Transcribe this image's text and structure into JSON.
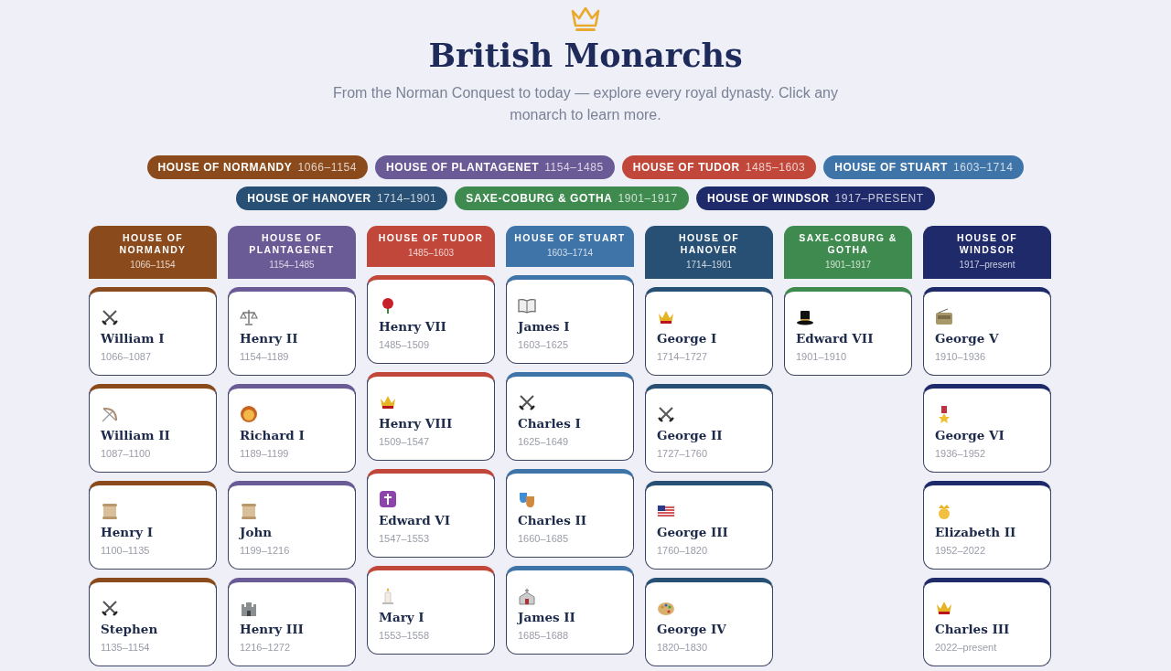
{
  "page": {
    "title": "British Monarchs",
    "subtitle": "From the Norman Conquest to today — explore every royal dynasty. Click any monarch to learn more."
  },
  "legend": [
    {
      "name": "HOUSE OF NORMANDY",
      "dates": "1066–1154",
      "color": "#8b4a1c"
    },
    {
      "name": "HOUSE OF PLANTAGENET",
      "dates": "1154–1485",
      "color": "#6a5a96"
    },
    {
      "name": "HOUSE OF TUDOR",
      "dates": "1485–1603",
      "color": "#c0473a"
    },
    {
      "name": "HOUSE OF STUART",
      "dates": "1603–1714",
      "color": "#3f74a8"
    },
    {
      "name": "HOUSE OF HANOVER",
      "dates": "1714–1901",
      "color": "#284f74"
    },
    {
      "name": "SAXE-COBURG & GOTHA",
      "dates": "1901–1917",
      "color": "#3f8a4f"
    },
    {
      "name": "HOUSE OF WINDSOR",
      "dates": "1917–PRESENT",
      "color": "#1f2a6a"
    }
  ],
  "houses": [
    {
      "name": "HOUSE OF NORMANDY",
      "dates": "1066–1154",
      "color": "#8b4a1c",
      "monarchs": [
        {
          "name": "William I",
          "reign": "1066–1087"
        },
        {
          "name": "William II",
          "reign": "1087–1100"
        },
        {
          "name": "Henry I",
          "reign": "1100–1135"
        },
        {
          "name": "Stephen",
          "reign": "1135–1154"
        }
      ]
    },
    {
      "name": "HOUSE OF PLANTAGENET",
      "dates": "1154–1485",
      "color": "#6a5a96",
      "monarchs": [
        {
          "name": "Henry II",
          "reign": "1154–1189"
        },
        {
          "name": "Richard I",
          "reign": "1189–1199"
        },
        {
          "name": "John",
          "reign": "1199–1216"
        },
        {
          "name": "Henry III",
          "reign": "1216–1272"
        }
      ]
    },
    {
      "name": "HOUSE OF TUDOR",
      "dates": "1485–1603",
      "color": "#c0473a",
      "monarchs": [
        {
          "name": "Henry VII",
          "reign": "1485–1509"
        },
        {
          "name": "Henry VIII",
          "reign": "1509–1547"
        },
        {
          "name": "Edward VI",
          "reign": "1547–1553"
        },
        {
          "name": "Mary I",
          "reign": "1553–1558"
        }
      ]
    },
    {
      "name": "HOUSE OF STUART",
      "dates": "1603–1714",
      "color": "#3f74a8",
      "monarchs": [
        {
          "name": "James I",
          "reign": "1603–1625"
        },
        {
          "name": "Charles I",
          "reign": "1625–1649"
        },
        {
          "name": "Charles II",
          "reign": "1660–1685"
        },
        {
          "name": "James II",
          "reign": "1685–1688"
        }
      ]
    },
    {
      "name": "HOUSE OF HANOVER",
      "dates": "1714–1901",
      "color": "#284f74",
      "monarchs": [
        {
          "name": "George I",
          "reign": "1714–1727"
        },
        {
          "name": "George II",
          "reign": "1727–1760"
        },
        {
          "name": "George III",
          "reign": "1760–1820"
        },
        {
          "name": "George IV",
          "reign": "1820–1830"
        }
      ]
    },
    {
      "name": "SAXE-COBURG & GOTHA",
      "dates": "1901–1917",
      "color": "#3f8a4f",
      "monarchs": [
        {
          "name": "Edward VII",
          "reign": "1901–1910"
        }
      ]
    },
    {
      "name": "HOUSE OF WINDSOR",
      "dates": "1917–present",
      "color": "#1f2a6a",
      "monarchs": [
        {
          "name": "George V",
          "reign": "1910–1936"
        },
        {
          "name": "George VI",
          "reign": "1936–1952"
        },
        {
          "name": "Elizabeth II",
          "reign": "1952–2022"
        },
        {
          "name": "Charles III",
          "reign": "2022–present"
        }
      ]
    }
  ]
}
